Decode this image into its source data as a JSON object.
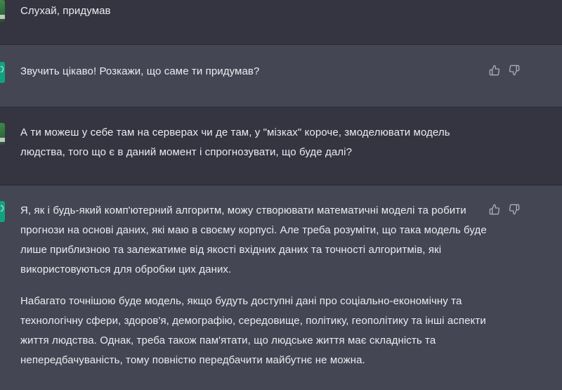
{
  "conversation": {
    "messages": [
      {
        "role": "user",
        "paragraphs": [
          "Слухай, придумав"
        ]
      },
      {
        "role": "assistant",
        "paragraphs": [
          "Звучить цікаво! Розкажи, що саме ти придумав?"
        ]
      },
      {
        "role": "user",
        "paragraphs": [
          "А ти можеш у себе там на серверах чи де там, у \"мізках\" короче, змоделювати модель людства, того що є в даний момент і спрогнозувати, що буде далі?"
        ]
      },
      {
        "role": "assistant",
        "paragraphs": [
          "Я, як і будь-який комп'ютерний алгоритм, можу створювати математичні моделі та робити прогнози на основі даних, які маю в своєму корпусі. Але треба розуміти, що така модель буде лише приблизною та залежатиме від якості вхідних даних та точності алгоритмів, які використовуються для обробки цих даних.",
          "Набагато точнішою буде модель, якщо будуть доступні дані про соціально-економічну та технологічну сфери, здоров'я, демографію, середовище, політику, геополітику та інші аспекти життя людства. Однак, треба також пам'ятати, що людське життя має складність та непередбачуваність, тому повністю передбачити майбутнє не можна."
        ]
      }
    ]
  },
  "icons": {
    "user_avatar": "user-avatar-icon",
    "assistant_avatar": "openai-logo-icon",
    "thumbs_up": "thumbs-up-icon",
    "thumbs_down": "thumbs-down-icon"
  },
  "colors": {
    "user_bg": "#343541",
    "assistant_bg": "#444654",
    "text": "#ececf1",
    "icon": "#acacbe",
    "assistant_avatar": "#10a37f"
  }
}
